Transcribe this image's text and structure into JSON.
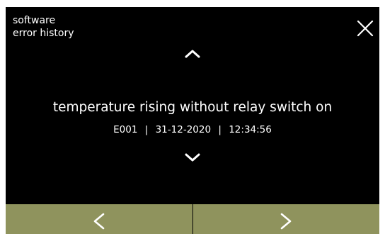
{
  "header": {
    "title_line1": "software",
    "title_line2": "error history",
    "close_icon": "close-icon"
  },
  "error": {
    "title": "temperature rising without relay switch on",
    "code": "E001",
    "date": "31-12-2020",
    "time": "12:34:56",
    "separator": "|"
  },
  "nav": {
    "up_icon": "chevron-up-icon",
    "down_icon": "chevron-down-icon",
    "prev_icon": "chevron-left-icon",
    "next_icon": "chevron-right-icon"
  },
  "colors": {
    "screen_bg": "#000000",
    "text": "#ffffff",
    "bottom_bar": "#8f935d",
    "divider": "#000000"
  }
}
